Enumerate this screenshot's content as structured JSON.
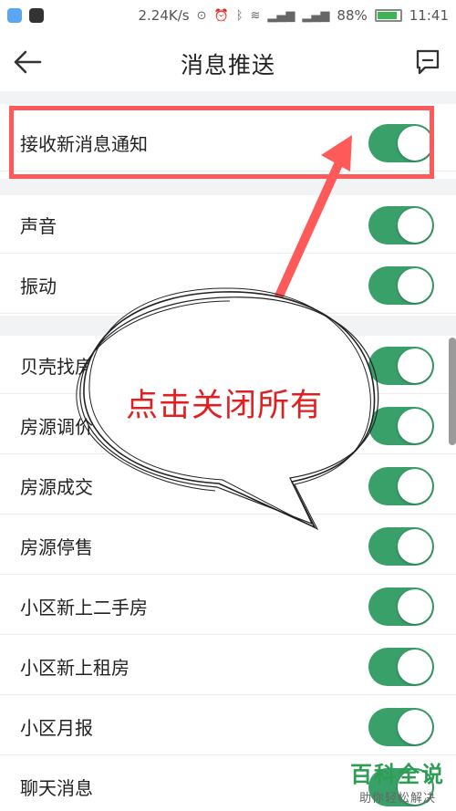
{
  "status_bar": {
    "speed": "2.24K/s",
    "battery": "88%",
    "time": "11:41"
  },
  "header": {
    "title": "消息推送",
    "back_icon": "arrow-left-icon",
    "feedback_icon": "message-icon"
  },
  "settings": {
    "main": {
      "label": "接收新消息通知",
      "enabled": true
    },
    "group1": [
      {
        "label": "声音",
        "enabled": true
      },
      {
        "label": "振动",
        "enabled": true
      }
    ],
    "group2": [
      {
        "label": "贝壳找房",
        "enabled": true
      },
      {
        "label": "房源调价",
        "enabled": true
      },
      {
        "label": "房源成交",
        "enabled": true
      },
      {
        "label": "房源停售",
        "enabled": true
      },
      {
        "label": "小区新上二手房",
        "enabled": true
      },
      {
        "label": "小区新上租房",
        "enabled": true
      },
      {
        "label": "小区月报",
        "enabled": true
      },
      {
        "label": "聊天消息",
        "enabled": true
      }
    ]
  },
  "annotation": {
    "text": "点击关闭所有",
    "color": "#ff5a5a"
  },
  "watermark": {
    "title": "百科全说",
    "subtitle": "助你轻松解决"
  },
  "colors": {
    "toggle_on": "#3aa06a",
    "background": "#f2f3f5"
  }
}
